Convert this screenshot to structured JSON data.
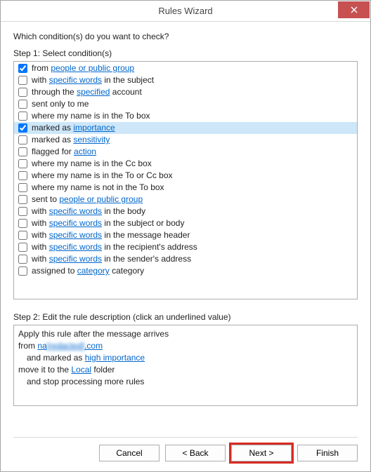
{
  "window": {
    "title": "Rules Wizard"
  },
  "prompt": "Which condition(s) do you want to check?",
  "step1_label": "Step 1: Select condition(s)",
  "step2_label": "Step 2: Edit the rule description (click an underlined value)",
  "conditions": [
    {
      "checked": true,
      "selected": false,
      "segments": [
        {
          "t": "from "
        },
        {
          "t": "people or public group",
          "link": true
        }
      ]
    },
    {
      "checked": false,
      "selected": false,
      "segments": [
        {
          "t": "with "
        },
        {
          "t": "specific words",
          "link": true
        },
        {
          "t": " in the subject"
        }
      ]
    },
    {
      "checked": false,
      "selected": false,
      "segments": [
        {
          "t": "through the "
        },
        {
          "t": "specified",
          "link": true
        },
        {
          "t": " account"
        }
      ]
    },
    {
      "checked": false,
      "selected": false,
      "segments": [
        {
          "t": "sent only to me"
        }
      ]
    },
    {
      "checked": false,
      "selected": false,
      "segments": [
        {
          "t": "where my name is in the To box"
        }
      ]
    },
    {
      "checked": true,
      "selected": true,
      "segments": [
        {
          "t": "marked as "
        },
        {
          "t": "importance",
          "link": true
        }
      ]
    },
    {
      "checked": false,
      "selected": false,
      "segments": [
        {
          "t": "marked as "
        },
        {
          "t": "sensitivity",
          "link": true
        }
      ]
    },
    {
      "checked": false,
      "selected": false,
      "segments": [
        {
          "t": "flagged for "
        },
        {
          "t": "action",
          "link": true
        }
      ]
    },
    {
      "checked": false,
      "selected": false,
      "segments": [
        {
          "t": "where my name is in the Cc box"
        }
      ]
    },
    {
      "checked": false,
      "selected": false,
      "segments": [
        {
          "t": "where my name is in the To or Cc box"
        }
      ]
    },
    {
      "checked": false,
      "selected": false,
      "segments": [
        {
          "t": "where my name is not in the To box"
        }
      ]
    },
    {
      "checked": false,
      "selected": false,
      "segments": [
        {
          "t": "sent to "
        },
        {
          "t": "people or public group",
          "link": true
        }
      ]
    },
    {
      "checked": false,
      "selected": false,
      "segments": [
        {
          "t": "with "
        },
        {
          "t": "specific words",
          "link": true
        },
        {
          "t": " in the body"
        }
      ]
    },
    {
      "checked": false,
      "selected": false,
      "segments": [
        {
          "t": "with "
        },
        {
          "t": "specific words",
          "link": true
        },
        {
          "t": " in the subject or body"
        }
      ]
    },
    {
      "checked": false,
      "selected": false,
      "segments": [
        {
          "t": "with "
        },
        {
          "t": "specific words",
          "link": true
        },
        {
          "t": " in the message header"
        }
      ]
    },
    {
      "checked": false,
      "selected": false,
      "segments": [
        {
          "t": "with "
        },
        {
          "t": "specific words",
          "link": true
        },
        {
          "t": " in the recipient's address"
        }
      ]
    },
    {
      "checked": false,
      "selected": false,
      "segments": [
        {
          "t": "with "
        },
        {
          "t": "specific words",
          "link": true
        },
        {
          "t": " in the sender's address"
        }
      ]
    },
    {
      "checked": false,
      "selected": false,
      "segments": [
        {
          "t": "assigned to "
        },
        {
          "t": "category",
          "link": true
        },
        {
          "t": " category"
        }
      ]
    }
  ],
  "description": {
    "line1_prefix": "Apply this rule after the message arrives",
    "line2_prefix": "from ",
    "line2_link_a": "na",
    "line2_link_b_blur": "[redacted]",
    "line2_link_c": ".com",
    "line3_prefix": "  and marked as ",
    "line3_link": "high importance",
    "line4_prefix": "move it to the ",
    "line4_link": "Local",
    "line4_suffix": " folder",
    "line5": "  and stop processing more rules"
  },
  "buttons": {
    "cancel": "Cancel",
    "back": "< Back",
    "next": "Next >",
    "finish": "Finish"
  }
}
